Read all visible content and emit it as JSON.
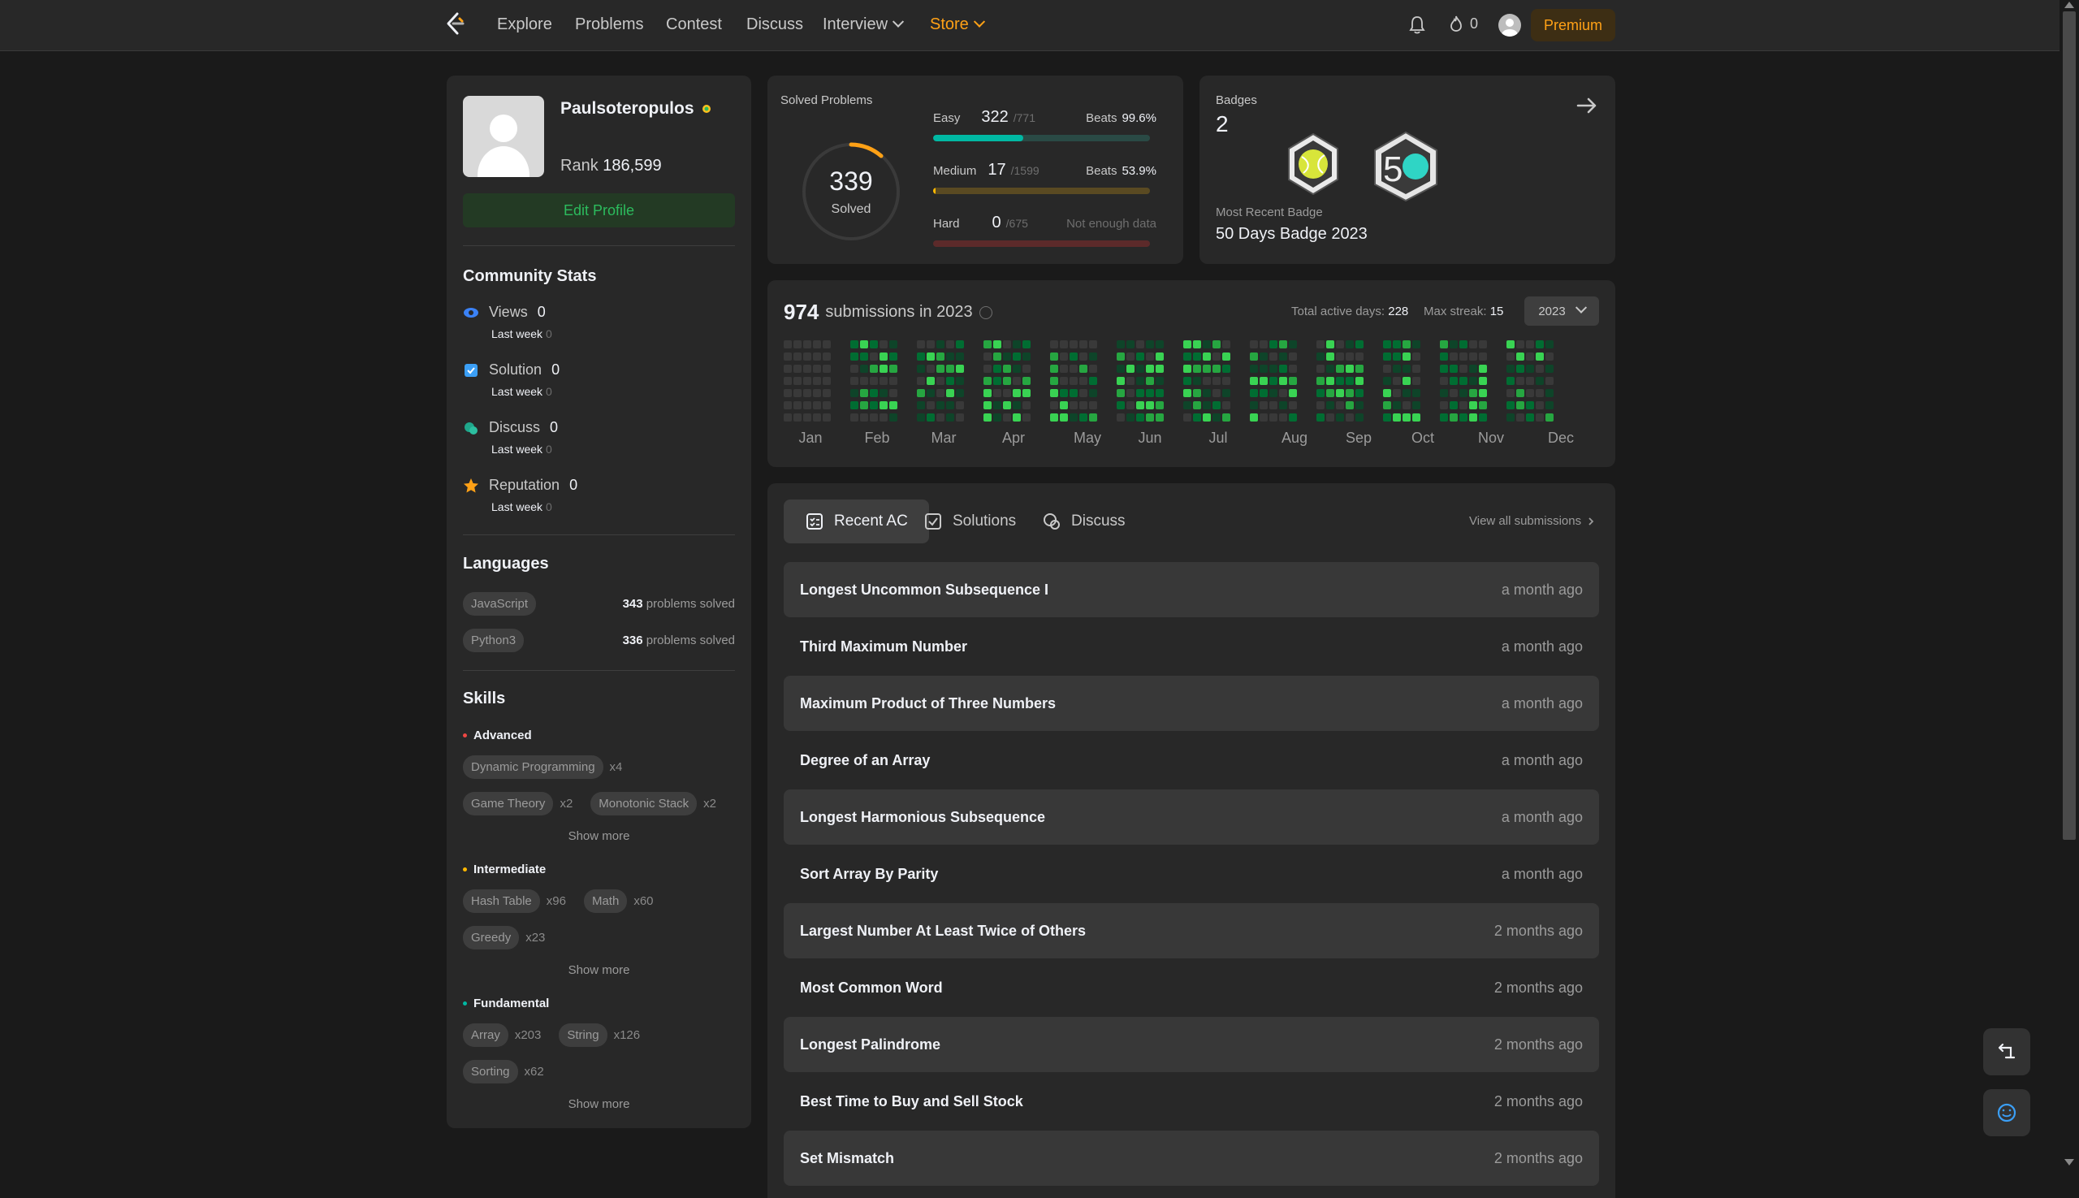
{
  "nav": {
    "links": [
      "Explore",
      "Problems",
      "Contest",
      "Discuss",
      "Interview",
      "Store"
    ],
    "streak_count": "0",
    "premium_label": "Premium"
  },
  "profile": {
    "username": "Paulsoteropulos",
    "rank_label": "Rank",
    "rank_value": "186,599",
    "edit_label": "Edit Profile"
  },
  "community": {
    "title": "Community Stats",
    "stats": [
      {
        "label": "Views",
        "value": "0",
        "last_week_label": "Last week",
        "last_week_value": "0"
      },
      {
        "label": "Solution",
        "value": "0",
        "last_week_label": "Last week",
        "last_week_value": "0"
      },
      {
        "label": "Discuss",
        "value": "0",
        "last_week_label": "Last week",
        "last_week_value": "0"
      },
      {
        "label": "Reputation",
        "value": "0",
        "last_week_label": "Last week",
        "last_week_value": "0"
      }
    ]
  },
  "languages": {
    "title": "Languages",
    "items": [
      {
        "name": "JavaScript",
        "count": "343",
        "suffix": "problems solved"
      },
      {
        "name": "Python3",
        "count": "336",
        "suffix": "problems solved"
      }
    ]
  },
  "skills": {
    "title": "Skills",
    "show_more": "Show more",
    "levels": [
      {
        "name": "Advanced",
        "color": "#ef4743",
        "tags": [
          {
            "name": "Dynamic Programming",
            "count": "x4"
          },
          {
            "name": "Game Theory",
            "count": "x2"
          },
          {
            "name": "Monotonic Stack",
            "count": "x2"
          }
        ]
      },
      {
        "name": "Intermediate",
        "color": "#ffb800",
        "tags": [
          {
            "name": "Hash Table",
            "count": "x96"
          },
          {
            "name": "Math",
            "count": "x60"
          },
          {
            "name": "Greedy",
            "count": "x23"
          }
        ]
      },
      {
        "name": "Fundamental",
        "color": "#00b8a3",
        "tags": [
          {
            "name": "Array",
            "count": "x203"
          },
          {
            "name": "String",
            "count": "x126"
          },
          {
            "name": "Sorting",
            "count": "x62"
          }
        ]
      }
    ]
  },
  "solved": {
    "title": "Solved Problems",
    "total": "339",
    "total_label": "Solved",
    "easy": {
      "label": "Easy",
      "count": "322",
      "total": "/771",
      "beats_label": "Beats",
      "beats": "99.6%",
      "fraction": 0.4176,
      "color": "#00b8a3",
      "track": "#2a4a45"
    },
    "medium": {
      "label": "Medium",
      "count": "17",
      "total": "/1599",
      "beats_label": "Beats",
      "beats": "53.9%",
      "fraction": 0.0106,
      "color": "#ffb800",
      "track": "#5a4a22"
    },
    "hard": {
      "label": "Hard",
      "count": "0",
      "total": "/675",
      "note": "Not enough data",
      "fraction": 0,
      "color": "#ef4743",
      "track": "#5c2a2a"
    }
  },
  "badges": {
    "title": "Badges",
    "count": "2",
    "recent_label": "Most Recent Badge",
    "recent_name": "50 Days Badge 2023"
  },
  "submissions": {
    "count": "974",
    "label": "submissions in 2023",
    "active_days_label": "Total active days:",
    "active_days": "228",
    "max_streak_label": "Max streak:",
    "max_streak": "15",
    "year": "2023",
    "months": [
      "Jan",
      "Feb",
      "Mar",
      "Apr",
      "May",
      "Jun",
      "Jul",
      "Aug",
      "Sep",
      "Oct",
      "Nov",
      "Dec"
    ]
  },
  "recent": {
    "tabs": [
      "Recent AC",
      "Solutions",
      "Discuss"
    ],
    "view_all": "View all submissions",
    "items": [
      {
        "name": "Longest Uncommon Subsequence I",
        "time": "a month ago"
      },
      {
        "name": "Third Maximum Number",
        "time": "a month ago"
      },
      {
        "name": "Maximum Product of Three Numbers",
        "time": "a month ago"
      },
      {
        "name": "Degree of an Array",
        "time": "a month ago"
      },
      {
        "name": "Longest Harmonious Subsequence",
        "time": "a month ago"
      },
      {
        "name": "Sort Array By Parity",
        "time": "a month ago"
      },
      {
        "name": "Largest Number At Least Twice of Others",
        "time": "2 months ago"
      },
      {
        "name": "Most Common Word",
        "time": "2 months ago"
      },
      {
        "name": "Longest Palindrome",
        "time": "2 months ago"
      },
      {
        "name": "Best Time to Buy and Sell Stock",
        "time": "2 months ago"
      },
      {
        "name": "Set Mismatch",
        "time": "2 months ago"
      }
    ]
  },
  "colors": {
    "accent": "#ffa116",
    "heat_empty": "#393939",
    "heat_levels": [
      "#0e4429",
      "#006d32",
      "#26a641",
      "#39d353"
    ]
  }
}
